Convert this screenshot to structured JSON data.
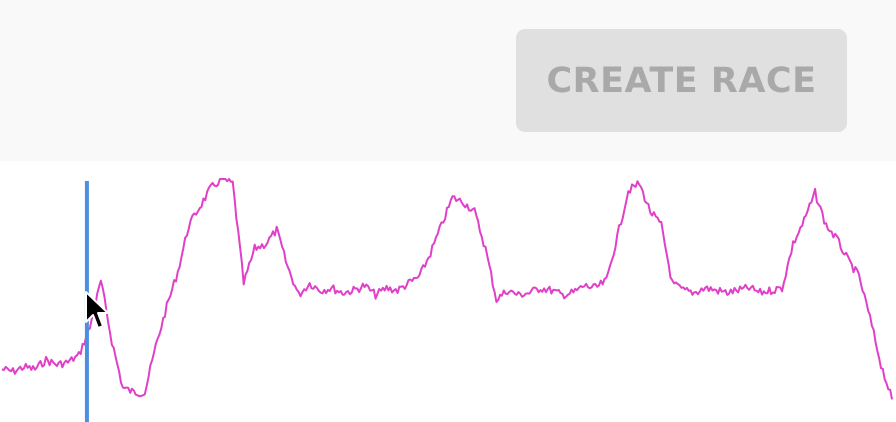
{
  "toolbar": {
    "create_race_label": "CREATE RACE",
    "create_race_enabled": false
  },
  "colors": {
    "trace": "#e040c8",
    "marker": "#4a8fe0",
    "button_bg": "#e0e0e0",
    "button_text": "#a9a9a9",
    "toolbar_bg": "#f9f9f9"
  },
  "chart_data": {
    "type": "line",
    "title": "",
    "xlabel": "",
    "ylabel": "",
    "grid": false,
    "legend": "none",
    "series": [
      {
        "values": [
          18,
          17,
          19,
          18,
          22,
          20,
          21,
          24,
          36,
          56,
          30,
          10,
          8,
          8,
          28,
          45,
          60,
          80,
          88,
          96,
          100,
          98,
          55,
          70,
          72,
          78,
          62,
          50,
          55,
          52,
          53,
          51,
          52,
          54,
          50,
          53,
          52,
          55,
          58,
          68,
          80,
          92,
          90,
          86,
          70,
          48,
          52,
          50,
          51,
          53,
          52,
          50,
          51,
          54,
          53,
          56,
          75,
          95,
          98,
          86,
          80,
          55,
          52,
          51,
          53,
          52,
          51,
          52,
          53,
          51,
          52,
          53,
          72,
          82,
          94,
          80,
          74,
          65,
          58,
          40,
          20,
          5
        ]
      }
    ],
    "marker_x_fraction": 0.097
  }
}
